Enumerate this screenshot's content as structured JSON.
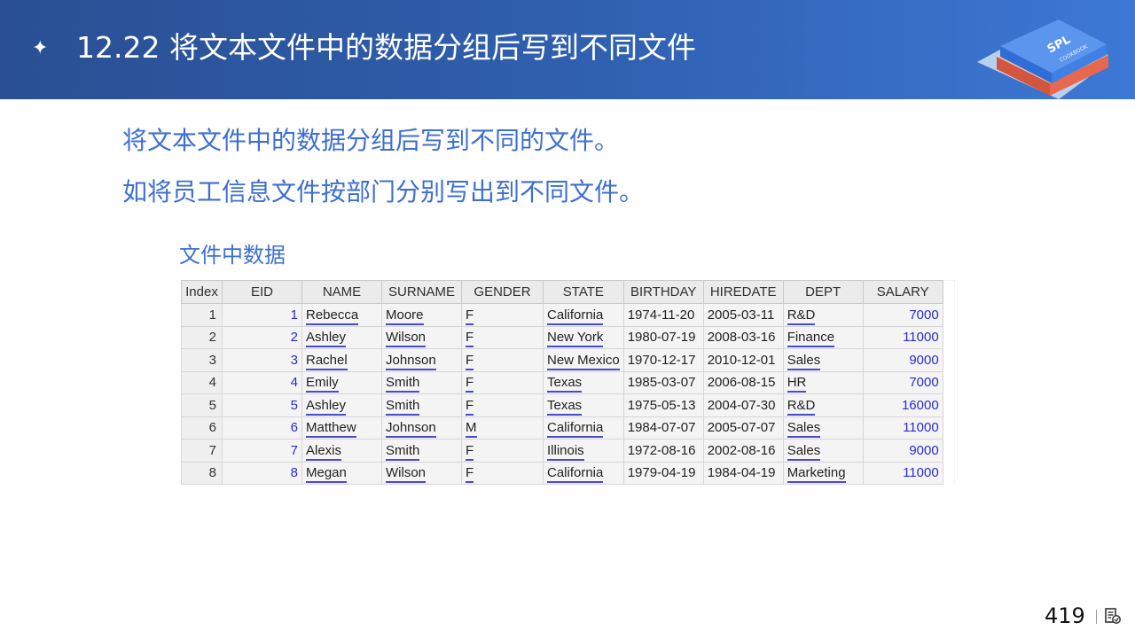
{
  "header": {
    "bullet": "✦",
    "title": "12.22 将文本文件中的数据分组后写到不同文件",
    "logo_text": "SPL",
    "logo_subtext": "COOKBOOK"
  },
  "intro": {
    "line1": "将文本文件中的数据分组后写到不同的文件。",
    "line2": "如将员工信息文件按部门分别写出到不同文件。"
  },
  "caption": "文件中数据",
  "table": {
    "columns": [
      "Index",
      "EID",
      "NAME",
      "SURNAME",
      "GENDER",
      "STATE",
      "BIRTHDAY",
      "HIREDATE",
      "DEPT",
      "SALARY"
    ],
    "rows": [
      [
        "1",
        "1",
        "Rebecca",
        "Moore",
        "F",
        "California",
        "1974-11-20",
        "2005-03-11",
        "R&D",
        "7000"
      ],
      [
        "2",
        "2",
        "Ashley",
        "Wilson",
        "F",
        "New York",
        "1980-07-19",
        "2008-03-16",
        "Finance",
        "11000"
      ],
      [
        "3",
        "3",
        "Rachel",
        "Johnson",
        "F",
        "New Mexico",
        "1970-12-17",
        "2010-12-01",
        "Sales",
        "9000"
      ],
      [
        "4",
        "4",
        "Emily",
        "Smith",
        "F",
        "Texas",
        "1985-03-07",
        "2006-08-15",
        "HR",
        "7000"
      ],
      [
        "5",
        "5",
        "Ashley",
        "Smith",
        "F",
        "Texas",
        "1975-05-13",
        "2004-07-30",
        "R&D",
        "16000"
      ],
      [
        "6",
        "6",
        "Matthew",
        "Johnson",
        "M",
        "California",
        "1984-07-07",
        "2005-07-07",
        "Sales",
        "11000"
      ],
      [
        "7",
        "7",
        "Alexis",
        "Smith",
        "F",
        "Illinois",
        "1972-08-16",
        "2002-08-16",
        "Sales",
        "9000"
      ],
      [
        "8",
        "8",
        "Megan",
        "Wilson",
        "F",
        "California",
        "1979-04-19",
        "1984-04-19",
        "Marketing",
        "11000"
      ]
    ]
  },
  "footer": {
    "page_number": "419"
  },
  "colors": {
    "header_start": "#2a4f93",
    "header_end": "#3d78d6",
    "accent_text": "#3d6fd1",
    "number_blue": "#2a2ad8"
  }
}
